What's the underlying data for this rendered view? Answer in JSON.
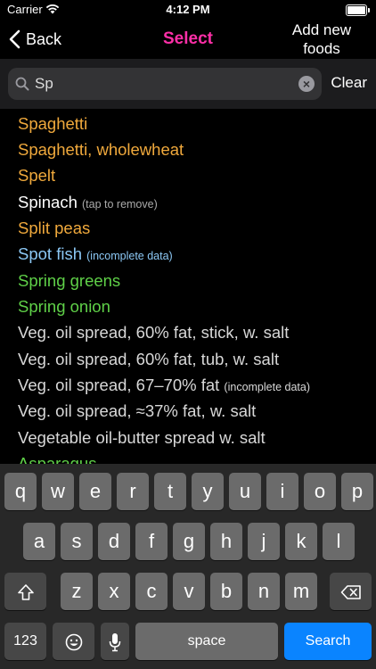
{
  "status_bar": {
    "carrier": "Carrier",
    "time": "4:12 PM"
  },
  "nav": {
    "back_label": "Back",
    "title": "Select",
    "add_line1": "Add new",
    "add_line2": "foods"
  },
  "search": {
    "value": "Sp",
    "clear_label": "Clear"
  },
  "colors": {
    "title": "#ff2fa8",
    "orange": "#f0a93c",
    "blue": "#8cc8f5",
    "green": "#5fd048",
    "search_key": "#0a84ff"
  },
  "foods": [
    {
      "name": "Spaghetti",
      "note": ""
    },
    {
      "name": "Spaghetti, wholewheat",
      "note": ""
    },
    {
      "name": "Spelt",
      "note": ""
    },
    {
      "name": "Spinach",
      "note": "(tap to remove)"
    },
    {
      "name": "Split peas",
      "note": ""
    },
    {
      "name": "Spot fish",
      "note": "(incomplete data)"
    },
    {
      "name": "Spring greens",
      "note": ""
    },
    {
      "name": "Spring onion",
      "note": ""
    },
    {
      "name": "Veg. oil spread, 60% fat, stick, w. salt",
      "note": ""
    },
    {
      "name": "Veg. oil spread, 60% fat, tub, w. salt",
      "note": ""
    },
    {
      "name": "Veg. oil spread, 67–70% fat",
      "note": "(incomplete data)"
    },
    {
      "name": "Veg. oil spread, ≈37% fat, w. salt",
      "note": ""
    },
    {
      "name": "Vegetable oil-butter spread w. salt",
      "note": ""
    },
    {
      "name": "Asparagus",
      "note": ""
    }
  ],
  "keyboard": {
    "row1": [
      "q",
      "w",
      "e",
      "r",
      "t",
      "y",
      "u",
      "i",
      "o",
      "p"
    ],
    "row2": [
      "a",
      "s",
      "d",
      "f",
      "g",
      "h",
      "j",
      "k",
      "l"
    ],
    "row3": [
      "z",
      "x",
      "c",
      "v",
      "b",
      "n",
      "m"
    ],
    "numbers_label": "123",
    "space_label": "space",
    "search_label": "Search"
  }
}
